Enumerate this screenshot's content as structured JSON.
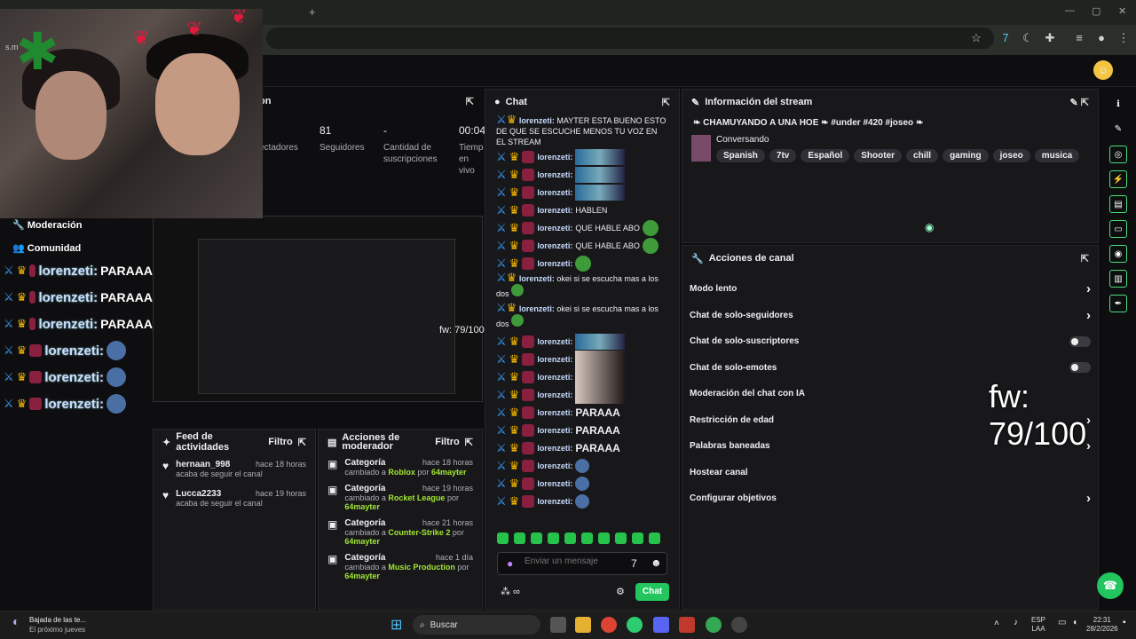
{
  "browser": {
    "tab_plus": "+"
  },
  "webcam": {
    "overlay_text": "s.m"
  },
  "stats": [
    {
      "value": "81",
      "label": "Seguidores"
    },
    {
      "value": "-",
      "label": "Cantidad de suscripciones"
    },
    {
      "value": "00:04",
      "label": "Tiempo en vivo"
    }
  ],
  "stats_title_partial": "on",
  "stats_viewers_partial": "ectadores",
  "left_menu": {
    "moderation": "Moderación",
    "community": "Comunidad"
  },
  "left_chat": [
    {
      "name": "lorenzeti:",
      "msg": "PARAAA"
    },
    {
      "name": "lorenzeti:",
      "msg": "PARAAA"
    },
    {
      "name": "lorenzeti:",
      "msg": "PARAAA"
    },
    {
      "name": "lorenzeti:",
      "msg": ""
    },
    {
      "name": "lorenzeti:",
      "msg": ""
    },
    {
      "name": "lorenzeti:",
      "msg": ""
    }
  ],
  "fw_small": "fw: 79/100",
  "fw_big": "fw: 79/100",
  "activity": {
    "title": "Feed de actividades",
    "filter": "Filtro",
    "items": [
      {
        "name": "hernaan_998",
        "time": "hace 18 horas",
        "sub": "acaba de seguir el canal"
      },
      {
        "name": "Lucca2233",
        "time": "hace 19 horas",
        "sub": "acaba de seguir el canal"
      }
    ]
  },
  "mod_actions": {
    "title": "Acciones de moderador",
    "filter": "Filtro",
    "items": [
      {
        "title": "Categoría",
        "time": "hace 18 horas",
        "pre": "cambiado a",
        "target": "Roblox",
        "by": "por",
        "user": "64mayter"
      },
      {
        "title": "Categoría",
        "time": "hace 19 horas",
        "pre": "cambiado a",
        "target": "Rocket League",
        "by": "por",
        "user": "64mayter"
      },
      {
        "title": "Categoría",
        "time": "hace 21 horas",
        "pre": "cambiado a",
        "target": "Counter-Strike 2",
        "by": "por",
        "user": "64mayter"
      },
      {
        "title": "Categoría",
        "time": "hace 1 día",
        "pre": "cambiado a",
        "target": "Music Production",
        "by": "por",
        "user": "64mayter"
      }
    ]
  },
  "chat": {
    "title": "Chat",
    "first_msg": "MAYTER ESTA BUENO ESTO DE QUE SE ESCUCHE MENOS TU VOZ EN EL STREAM",
    "rows": [
      {
        "name": "lorenzeti:",
        "text": "",
        "emote": "img"
      },
      {
        "name": "lorenzeti:",
        "text": "",
        "emote": "img"
      },
      {
        "name": "lorenzeti:",
        "text": "",
        "emote": "img"
      },
      {
        "name": "lorenzeti:",
        "text": "HABLEN",
        "emote": ""
      },
      {
        "name": "lorenzeti:",
        "text": "QUE HABLE ABO",
        "emote": "pepe"
      },
      {
        "name": "lorenzeti:",
        "text": "QUE HABLE ABO",
        "emote": "pepe"
      },
      {
        "name": "lorenzeti:",
        "text": "",
        "emote": "pepe"
      }
    ],
    "multi": [
      {
        "name": "lorenzeti:",
        "text": "okei si se escucha mas a los dos"
      },
      {
        "name": "lorenzeti:",
        "text": "okei si se escucha mas a los dos"
      }
    ],
    "rows2": [
      {
        "name": "lorenzeti:",
        "text": "",
        "emote": "img"
      },
      {
        "name": "lorenzeti:",
        "text": "",
        "emote": "face"
      },
      {
        "name": "lorenzeti:",
        "text": "",
        "emote": "face"
      },
      {
        "name": "lorenzeti:",
        "text": "",
        "emote": "face"
      },
      {
        "name": "lorenzeti:",
        "text": "PARAAA",
        "emote": ""
      },
      {
        "name": "lorenzeti:",
        "text": "PARAAA",
        "emote": ""
      },
      {
        "name": "lorenzeti:",
        "text": "PARAAA",
        "emote": ""
      },
      {
        "name": "lorenzeti:",
        "text": "",
        "emote": "bubble"
      },
      {
        "name": "lorenzeti:",
        "text": "",
        "emote": "bubble"
      },
      {
        "name": "lorenzeti:",
        "text": "",
        "emote": "bubble"
      }
    ],
    "placeholder": "Enviar un mensaje",
    "send": "Chat"
  },
  "stream_info": {
    "title": "Información del stream",
    "stream_title": "CHAMUYANDO A UNA HOE",
    "hashtags": "#under #420 #joseo",
    "category": "Conversando",
    "tags": [
      "Spanish",
      "7tv",
      "Español",
      "Shooter",
      "chill",
      "gaming",
      "joseo",
      "musica"
    ]
  },
  "channel_actions": {
    "title": "Acciones de canal",
    "items": [
      {
        "label": "Modo lento",
        "control": "chevron"
      },
      {
        "label": "Chat de solo-seguidores",
        "control": "chevron"
      },
      {
        "label": "Chat de solo-suscriptores",
        "control": "toggle"
      },
      {
        "label": "Chat de solo-emotes",
        "control": "toggle"
      },
      {
        "label": "Moderación del chat con IA",
        "control": "none"
      },
      {
        "label": "Restricción de edad",
        "control": "chevron"
      },
      {
        "label": "Palabras baneadas",
        "control": "chevron"
      },
      {
        "label": "Hostear canal",
        "control": "none"
      },
      {
        "label": "Configurar objetivos",
        "control": "chevron"
      }
    ]
  },
  "taskbar": {
    "notif_title": "Bajada de las te...",
    "notif_sub": "El próximo jueves",
    "search": "Buscar",
    "lang1": "ESP",
    "lang2": "LAA",
    "time": "22:31",
    "date": "28/2/2026"
  },
  "colors": {
    "accent": "#22c55e",
    "bg": "#0e0e10",
    "panel": "#18181b"
  }
}
